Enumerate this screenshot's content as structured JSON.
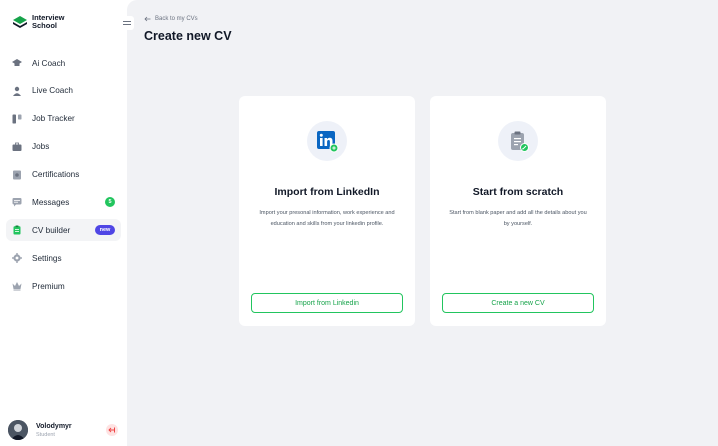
{
  "brand": {
    "name_line1": "Interview",
    "name_line2": "School"
  },
  "sidebar": {
    "collapse_icon": "double-line-icon",
    "items": [
      {
        "label": "Ai Coach",
        "icon": "graduation-cap-icon"
      },
      {
        "label": "Live Coach",
        "icon": "person-icon"
      },
      {
        "label": "Job Tracker",
        "icon": "kanban-icon"
      },
      {
        "label": "Jobs",
        "icon": "briefcase-icon"
      },
      {
        "label": "Certifications",
        "icon": "certificate-icon"
      },
      {
        "label": "Messages",
        "icon": "chat-icon",
        "badge": "5"
      },
      {
        "label": "CV builder",
        "icon": "clipboard-icon",
        "badge": "new",
        "active": true
      },
      {
        "label": "Settings",
        "icon": "gear-icon"
      },
      {
        "label": "Premium",
        "icon": "crown-icon"
      }
    ]
  },
  "user": {
    "name": "Volodymyr",
    "role": "Student"
  },
  "main": {
    "back_label": "Back to my CVs",
    "title": "Create new CV",
    "cards": [
      {
        "title": "Import from LinkedIn",
        "description": "Import your presonal information, work experience and education and skills from your linkedin profile.",
        "button": "Import from Linkedin",
        "icon": "linkedin-icon"
      },
      {
        "title": "Start from scratch",
        "description": "Start from blank paper and add all the details about you by yourself.",
        "button": "Create a new CV",
        "icon": "clipboard-edit-icon"
      }
    ]
  },
  "colors": {
    "accent": "#22c55e",
    "badge_blue": "#4f46e5",
    "background": "#f1f2f5",
    "linkedin": "#0a66c2"
  }
}
